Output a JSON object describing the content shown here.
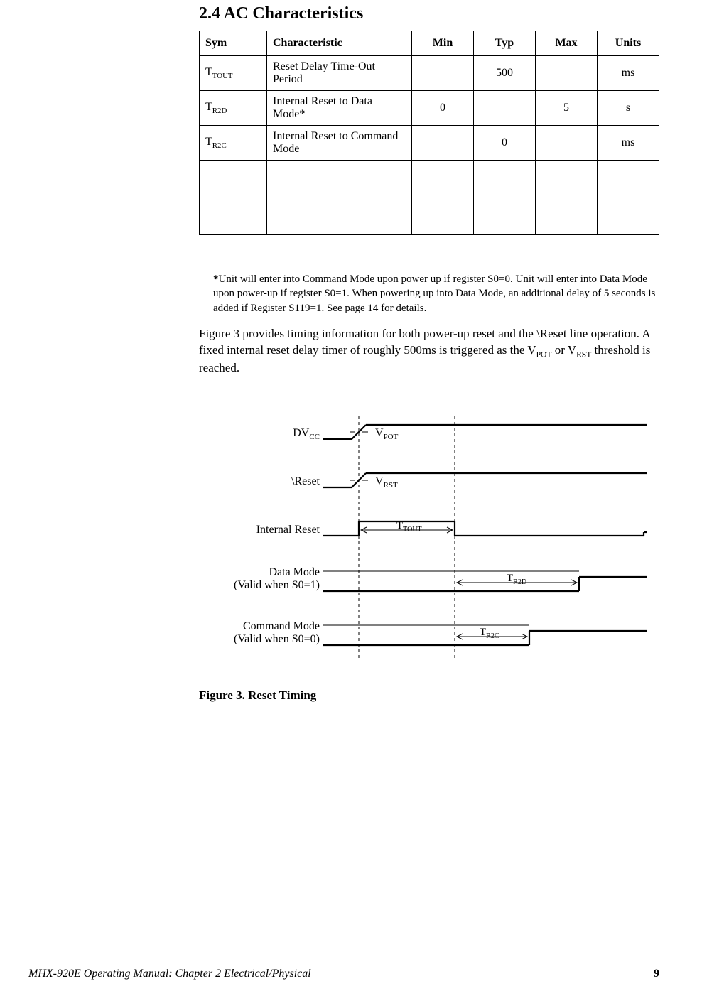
{
  "heading": "2.4  AC Characteristics",
  "table": {
    "headers": [
      "Sym",
      "Characteristic",
      "Min",
      "Typ",
      "Max",
      "Units"
    ],
    "rows": [
      {
        "sym": "T",
        "symsub": "TOUT",
        "char": "Reset Delay Time-Out Period",
        "min": "",
        "typ": "500",
        "max": "",
        "units": "ms"
      },
      {
        "sym": "T",
        "symsub": "R2D",
        "char": "Internal Reset to Data Mode*",
        "min": "0",
        "typ": "",
        "max": "5",
        "units": "s"
      },
      {
        "sym": "T",
        "symsub": "R2C",
        "char": "Internal Reset to Command Mode",
        "min": "",
        "typ": "0",
        "max": "",
        "units": "ms"
      },
      {
        "sym": "",
        "symsub": "",
        "char": "",
        "min": "",
        "typ": "",
        "max": "",
        "units": ""
      },
      {
        "sym": "",
        "symsub": "",
        "char": "",
        "min": "",
        "typ": "",
        "max": "",
        "units": ""
      },
      {
        "sym": "",
        "symsub": "",
        "char": "",
        "min": "",
        "typ": "",
        "max": "",
        "units": ""
      }
    ]
  },
  "footnote_bold": "*",
  "footnote": "Unit will enter into Command Mode upon power up if register S0=0.  Unit will enter into Data Mode upon power-up if register S0=1.  When powering up into Data Mode, an additional delay of 5 seconds is added if Register S119=1.  See page 14 for details.",
  "para_before": "Figure 3 provides timing information for both power-up reset and the \\Reset line operation.  A fixed internal reset delay timer of roughly 500ms is triggered as the V",
  "para_sub1": "POT",
  "para_mid": " or V",
  "para_sub2": "RST",
  "para_after": " threshold is reached.",
  "diagram": {
    "labels": {
      "dvcc": "DV",
      "dvcc_sub": "CC",
      "vpot": "V",
      "vpot_sub": "POT",
      "reset": "\\Reset",
      "vrst": "V",
      "vrst_sub": "RST",
      "internal_reset": "Internal Reset",
      "ttout": "T",
      "ttout_sub": "TOUT",
      "data_mode_l1": "Data Mode",
      "data_mode_l2": "(Valid when S0=1)",
      "tr2d": "T",
      "tr2d_sub": "R2D",
      "cmd_mode_l1": "Command Mode",
      "cmd_mode_l2": "(Valid when S0=0)",
      "tr2c": "T",
      "tr2c_sub": "R2C"
    }
  },
  "fig_caption": "Figure 3.  Reset Timing",
  "footer_left": "MHX-920E Operating Manual: Chapter 2 Electrical/Physical",
  "footer_right": "9"
}
